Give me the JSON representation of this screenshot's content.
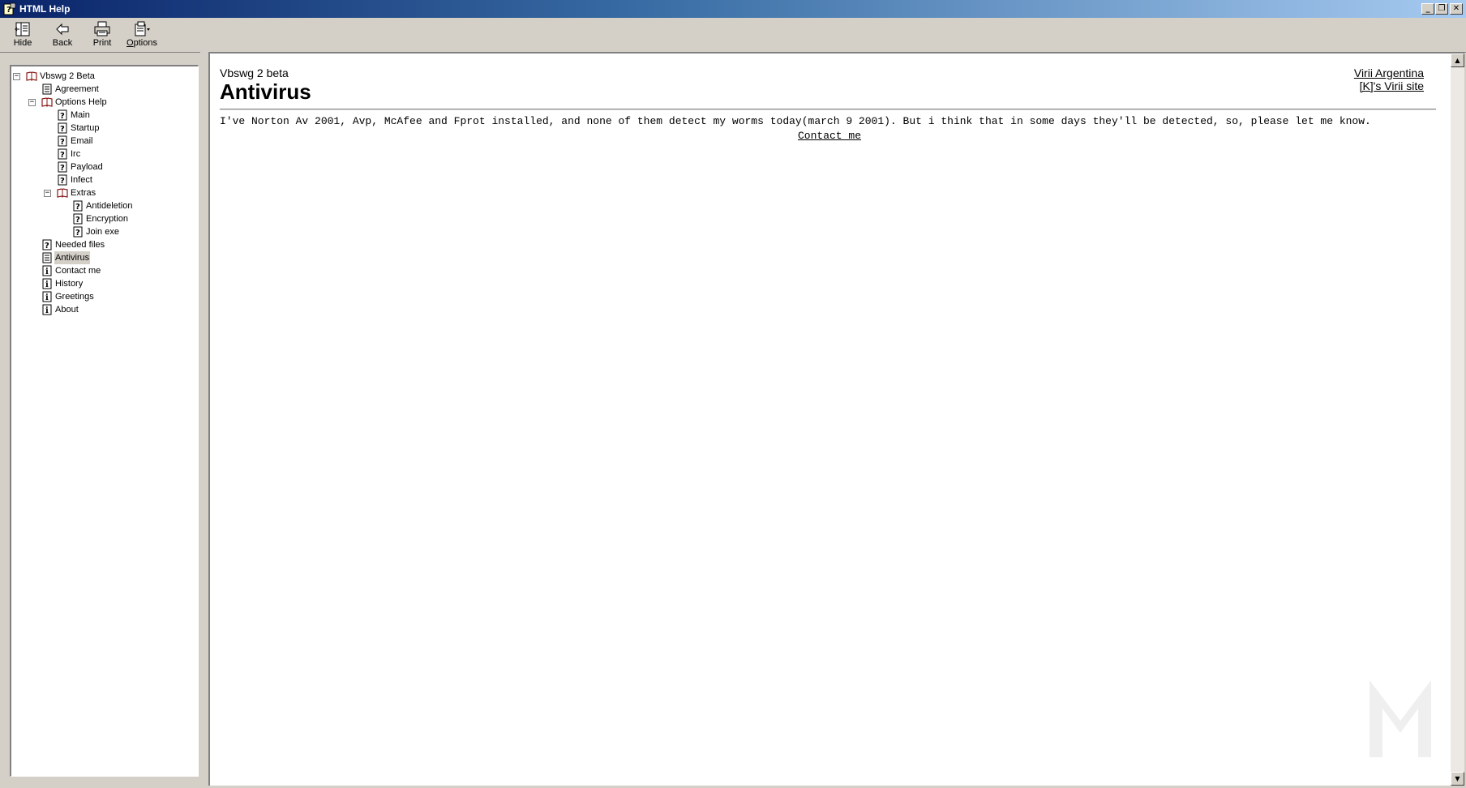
{
  "window": {
    "title": "HTML Help",
    "controls": {
      "minimize": "_",
      "restore": "❐",
      "close": "✕"
    }
  },
  "toolbar": {
    "hide_label": "Hide",
    "back_label": "Back",
    "print_label": "Print",
    "options_label": "Options"
  },
  "tree": {
    "items": [
      {
        "label": "Vbswg 2 Beta",
        "type": "book-open",
        "expander": "−"
      },
      {
        "label": "Agreement",
        "type": "page"
      },
      {
        "label": "Options Help",
        "type": "book-open",
        "expander": "−"
      },
      {
        "label": "Main",
        "type": "question"
      },
      {
        "label": "Startup",
        "type": "question"
      },
      {
        "label": "Email",
        "type": "question"
      },
      {
        "label": "Irc",
        "type": "question"
      },
      {
        "label": "Payload",
        "type": "question"
      },
      {
        "label": "Infect",
        "type": "question"
      },
      {
        "label": "Extras",
        "type": "book-open",
        "expander": "−"
      },
      {
        "label": "Antideletion",
        "type": "question"
      },
      {
        "label": "Encryption",
        "type": "question"
      },
      {
        "label": "Join exe",
        "type": "question"
      },
      {
        "label": "Needed files",
        "type": "question"
      },
      {
        "label": "Antivirus",
        "type": "page",
        "selected": true
      },
      {
        "label": "Contact me",
        "type": "info"
      },
      {
        "label": "History",
        "type": "info"
      },
      {
        "label": "Greetings",
        "type": "info"
      },
      {
        "label": "About",
        "type": "info"
      }
    ]
  },
  "content": {
    "subtitle": "Vbswg 2 beta",
    "title": "Antivirus",
    "links": [
      "Virii Argentina",
      "[K]'s Virii site"
    ],
    "body": "I've Norton Av 2001, Avp, McAfee and Fprot installed, and none of them detect my worms today(march 9 2001). But i think that in some days they'll be detected, so, please let me know.",
    "contact_link": "Contact me"
  },
  "scrollbar": {
    "up": "▲",
    "down": "▼"
  },
  "colors": {
    "titlebar_start": "#0a246a",
    "titlebar_end": "#a6caf0",
    "chrome": "#d4d0c8",
    "book_icon": "#8b1a1a",
    "selection": "#d4d0c8"
  }
}
